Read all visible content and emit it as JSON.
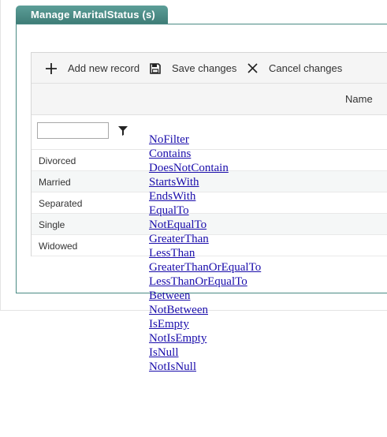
{
  "tab": {
    "title": "Manage MaritalStatus (s)"
  },
  "toolbar": {
    "add_label": "Add new record",
    "save_label": "Save changes",
    "cancel_label": "Cancel changes"
  },
  "grid": {
    "columns": [
      "Name"
    ],
    "filter": {
      "value": ""
    },
    "rows": [
      "Divorced",
      "Married",
      "Separated",
      "Single",
      "Widowed"
    ]
  },
  "filter_menu": {
    "items": [
      "NoFilter",
      "Contains",
      "DoesNotContain",
      "StartsWith",
      "EndsWith",
      "EqualTo",
      "NotEqualTo",
      "GreaterThan",
      "LessThan",
      "GreaterThanOrEqualTo",
      "LessThanOrEqualTo",
      "Between",
      "NotBetween",
      "IsEmpty",
      "NotIsEmpty",
      "IsNull",
      "NotIsNull"
    ]
  },
  "colors": {
    "tab_bg": "#4a8a84",
    "link": "#1a0dab"
  },
  "icons": {
    "add": "plus-icon",
    "save": "save-icon",
    "cancel": "close-icon",
    "filter": "filter-icon"
  }
}
